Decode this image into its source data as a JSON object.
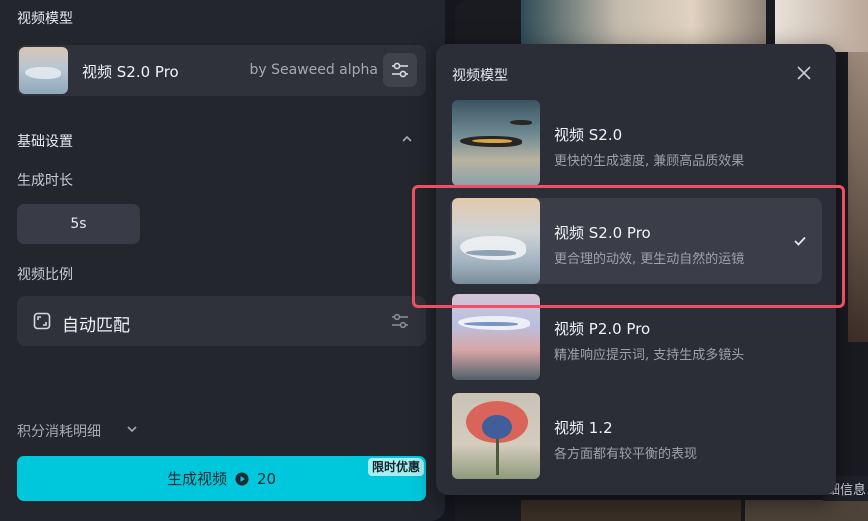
{
  "left": {
    "model_section_title": "视频模型",
    "model_name": "视频 S2.0 Pro",
    "model_by": "by Seaweed alpha",
    "basic_settings_title": "基础设置",
    "duration_label": "生成时长",
    "duration_value": "5s",
    "ratio_label": "视频比例",
    "ratio_value": "自动匹配",
    "cost_label": "积分消耗明细",
    "generate_label": "生成视频",
    "generate_cost": "20",
    "promo_badge": "限时优惠"
  },
  "popover": {
    "title": "视频模型",
    "options": [
      {
        "name": "视频 S2.0",
        "desc": "更快的生成速度, 兼顾高品质效果",
        "selected": false
      },
      {
        "name": "视频 S2.0 Pro",
        "desc": "更合理的动效, 更生动自然的运镜",
        "selected": true
      },
      {
        "name": "视频 P2.0 Pro",
        "desc": "精准响应提示词, 支持生成多镜头",
        "selected": false
      },
      {
        "name": "视频 1.2",
        "desc": "各方面都有较平衡的表现",
        "selected": false
      }
    ]
  },
  "background": {
    "detail_text": "细信息"
  },
  "colors": {
    "accent": "#00c8dc",
    "highlight": "#ef4e63",
    "panel": "#24262e",
    "popover": "#2b2e36"
  }
}
